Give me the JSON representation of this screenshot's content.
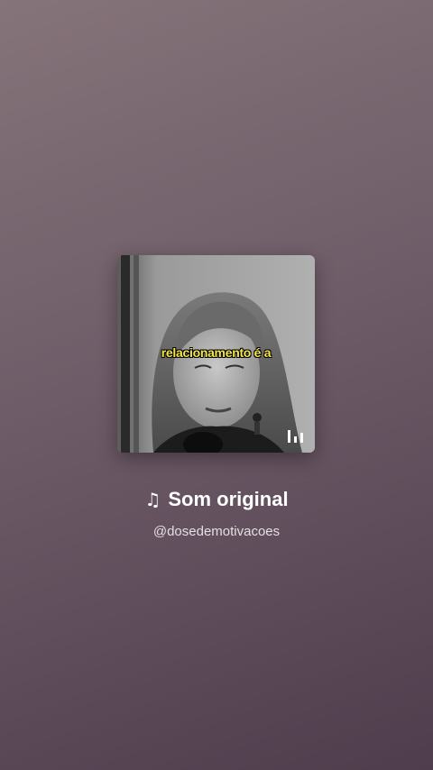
{
  "audio": {
    "title": "Som original",
    "note_icon": "♫",
    "author_handle": "@dosedemotivacoes"
  },
  "thumbnail": {
    "caption": "relacionamento é a",
    "overlay_icon": "equalizer-bars-icon"
  },
  "colors": {
    "caption_text": "#f5e84a",
    "title_text": "#ffffff",
    "handle_text": "#e6dde3"
  }
}
